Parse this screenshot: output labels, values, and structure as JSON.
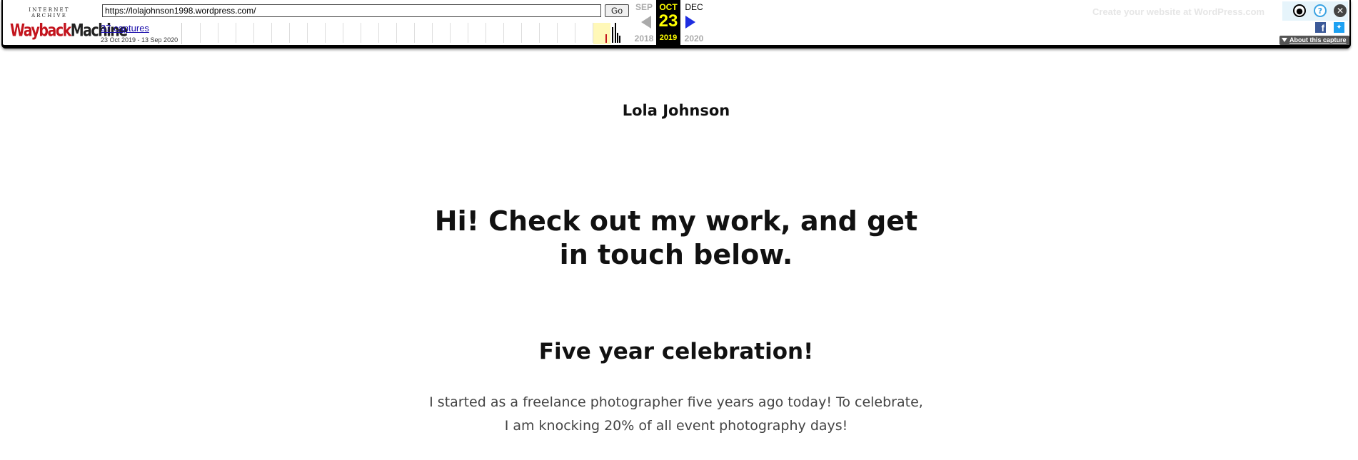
{
  "wayback": {
    "logo_top": "INTERNET ARCHIVE",
    "logo_way": "Wayback",
    "logo_machine": "Machine",
    "url_value": "https://lolajohnson1998.wordpress.com/",
    "go_label": "Go",
    "captures_label": "37 captures",
    "date_range": "23 Oct 2019 - 13 Sep 2020",
    "prev_month": "SEP",
    "current_month": "OCT",
    "current_day": "23",
    "current_year": "2019",
    "next_month": "DEC",
    "prev_year": "2018",
    "next_year": "2020",
    "wordpress_promo": "Create your website at WordPress.com",
    "about_label": "About this capture",
    "icons": [
      "user-icon",
      "help-icon",
      "close-icon",
      "facebook-icon",
      "twitter-icon"
    ],
    "colors": {
      "current_bg": "#000000",
      "current_text": "#ffff00",
      "next_arrow": "#1e2de0",
      "prev_arrow": "#aaaaaa",
      "logo_red": "#c3141d"
    }
  },
  "site": {
    "title": "Lola Johnson",
    "hero": "Hi! Check out my work, and get in touch below.",
    "section_heading": "Five year celebration!",
    "section_text": "I started as a freelance photographer five years ago today! To celebrate, I am knocking 20% of all event photography days!"
  }
}
